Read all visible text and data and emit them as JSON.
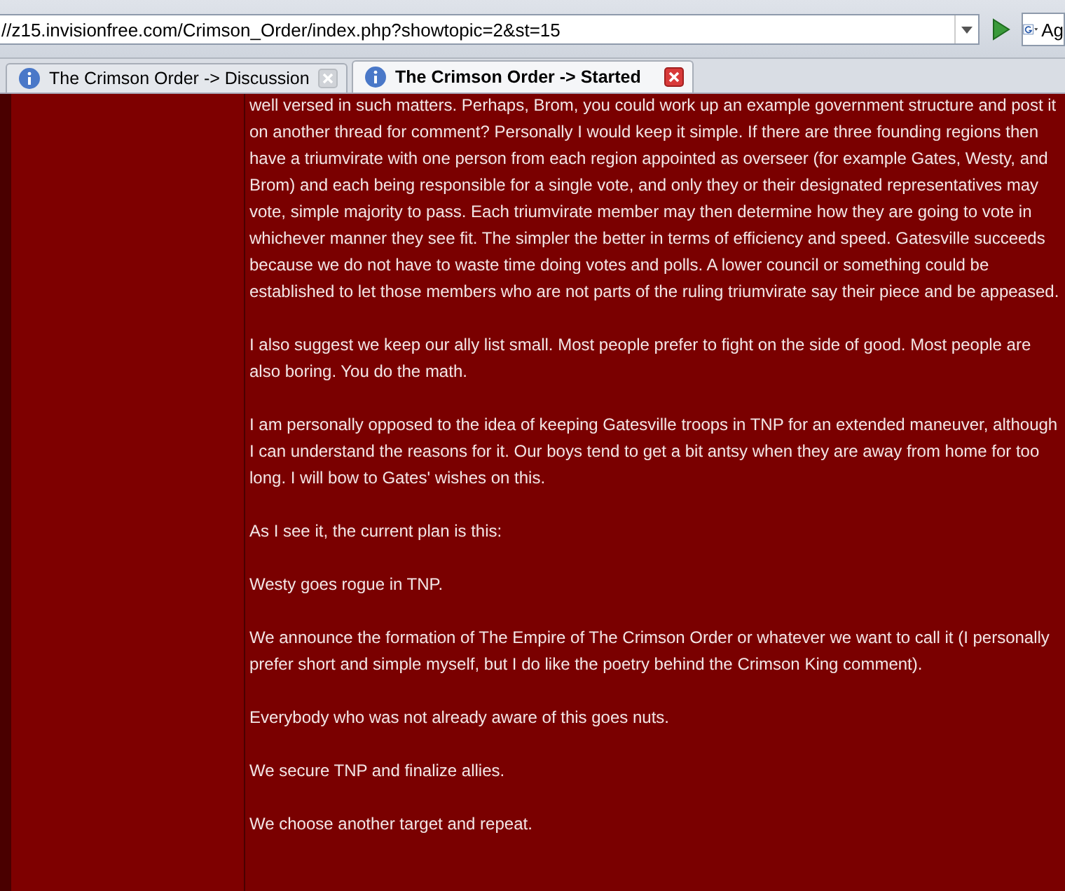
{
  "address_bar": {
    "url": "//z15.invisionfree.com/Crimson_Order/index.php?showtopic=2&st=15",
    "search_text": "Ag"
  },
  "tabs": [
    {
      "title": "The Crimson Order -> Discussion",
      "selected": false
    },
    {
      "title": "The Crimson Order -> Started",
      "selected": true
    }
  ],
  "post": {
    "paragraphs": [
      "well versed in such matters. Perhaps, Brom, you could work up an example government structure and post it on another thread for comment? Personally I would keep it simple. If there are three founding regions then have a triumvirate with one person from each region appointed as overseer (for example Gates, Westy, and Brom) and each being responsible for a single vote, and only they or their designated representatives may vote, simple majority to pass. Each triumvirate member may then determine how they are going to vote in whichever manner they see fit. The simpler the better in terms of efficiency and speed. Gatesville succeeds because we do not have to waste time doing votes and polls. A lower council or something could be established to let those members who are not parts of the ruling triumvirate say their piece and be appeased.",
      "I also suggest we keep our ally list small. Most people prefer to fight on the side of good. Most people are also boring. You do the math.",
      "I am personally opposed to the idea of keeping Gatesville troops in TNP for an extended maneuver, although I can understand the reasons for it. Our boys tend to get a bit antsy when they are away from home for too long. I will bow to Gates' wishes on this.",
      "As I see it, the current plan is this:",
      "Westy goes rogue in TNP.",
      "We announce the formation of The Empire of The Crimson Order or whatever we want to call it (I personally prefer short and simple myself, but I do like the poetry behind the Crimson King comment).",
      "Everybody who was not already aware of this goes nuts.",
      "We secure TNP and finalize allies.",
      "We choose another target and repeat."
    ]
  }
}
